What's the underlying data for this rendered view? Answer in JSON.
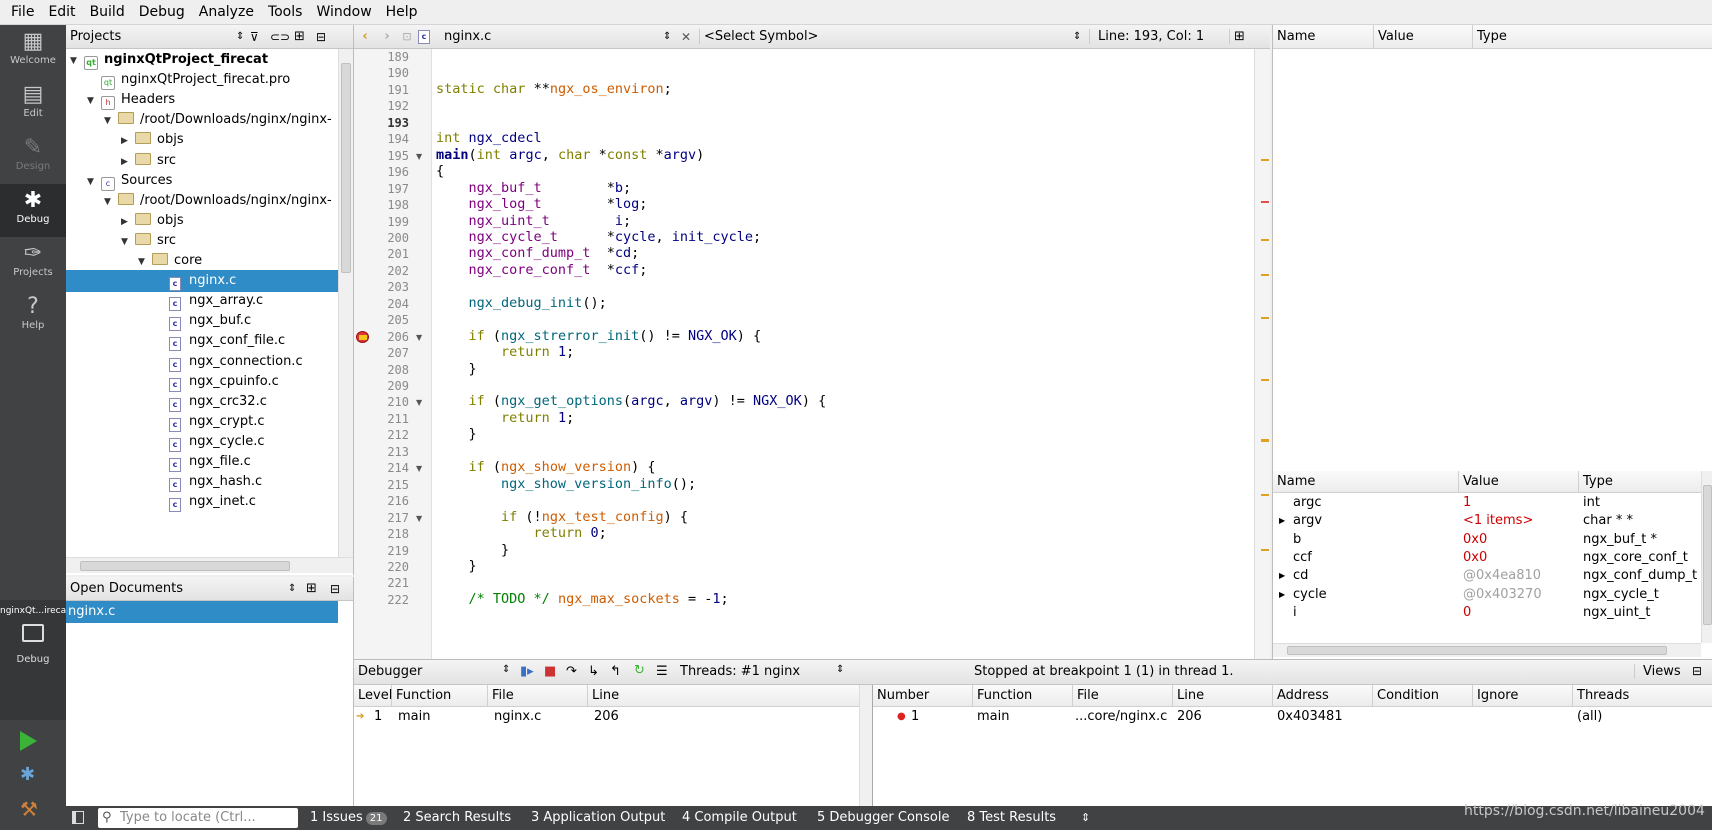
{
  "menu": [
    "File",
    "Edit",
    "Build",
    "Debug",
    "Analyze",
    "Tools",
    "Window",
    "Help"
  ],
  "modes": [
    {
      "label": "Welcome",
      "icon": "grid-icon",
      "glyph": "▦"
    },
    {
      "label": "Edit",
      "icon": "document-icon",
      "glyph": "▤"
    },
    {
      "label": "Design",
      "icon": "pencil-icon",
      "glyph": "✎"
    },
    {
      "label": "Debug",
      "icon": "bug-icon",
      "glyph": "✱"
    },
    {
      "label": "Projects",
      "icon": "wrench-icon",
      "glyph": "✑"
    },
    {
      "label": "Help",
      "icon": "help-icon",
      "glyph": "?"
    }
  ],
  "kit": {
    "project": "nginxQt...irecat",
    "mode": "Debug"
  },
  "projects": {
    "title": "Projects",
    "items": [
      {
        "text": "nginxQtProject_firecat",
        "depth": 0,
        "arrow": "down",
        "icon": "project",
        "bold": true
      },
      {
        "text": "nginxQtProject_firecat.pro",
        "depth": 1,
        "arrow": "",
        "icon": "pro"
      },
      {
        "text": "Headers",
        "depth": 1,
        "arrow": "down",
        "icon": "hdr"
      },
      {
        "text": "/root/Downloads/nginx/nginx-",
        "depth": 2,
        "arrow": "down",
        "icon": "folder"
      },
      {
        "text": "objs",
        "depth": 3,
        "arrow": "right",
        "icon": "folder"
      },
      {
        "text": "src",
        "depth": 3,
        "arrow": "right",
        "icon": "folder"
      },
      {
        "text": "Sources",
        "depth": 1,
        "arrow": "down",
        "icon": "src"
      },
      {
        "text": "/root/Downloads/nginx/nginx-",
        "depth": 2,
        "arrow": "down",
        "icon": "folder"
      },
      {
        "text": "objs",
        "depth": 3,
        "arrow": "right",
        "icon": "folder"
      },
      {
        "text": "src",
        "depth": 3,
        "arrow": "down",
        "icon": "folder"
      },
      {
        "text": "core",
        "depth": 4,
        "arrow": "down",
        "icon": "folder"
      },
      {
        "text": "nginx.c",
        "depth": 5,
        "arrow": "",
        "icon": "c",
        "selected": true
      },
      {
        "text": "ngx_array.c",
        "depth": 5,
        "arrow": "",
        "icon": "c"
      },
      {
        "text": "ngx_buf.c",
        "depth": 5,
        "arrow": "",
        "icon": "c"
      },
      {
        "text": "ngx_conf_file.c",
        "depth": 5,
        "arrow": "",
        "icon": "c"
      },
      {
        "text": "ngx_connection.c",
        "depth": 5,
        "arrow": "",
        "icon": "c"
      },
      {
        "text": "ngx_cpuinfo.c",
        "depth": 5,
        "arrow": "",
        "icon": "c"
      },
      {
        "text": "ngx_crc32.c",
        "depth": 5,
        "arrow": "",
        "icon": "c"
      },
      {
        "text": "ngx_crypt.c",
        "depth": 5,
        "arrow": "",
        "icon": "c"
      },
      {
        "text": "ngx_cycle.c",
        "depth": 5,
        "arrow": "",
        "icon": "c"
      },
      {
        "text": "ngx_file.c",
        "depth": 5,
        "arrow": "",
        "icon": "c"
      },
      {
        "text": "ngx_hash.c",
        "depth": 5,
        "arrow": "",
        "icon": "c"
      },
      {
        "text": "ngx_inet.c",
        "depth": 5,
        "arrow": "",
        "icon": "c"
      }
    ]
  },
  "open_documents": {
    "title": "Open Documents",
    "items": [
      "nginx.c"
    ]
  },
  "editor": {
    "file": "nginx.c",
    "symbol": "<Select Symbol>",
    "position": "Line: 193, Col: 1",
    "lines": [
      {
        "n": "189",
        "html": ""
      },
      {
        "n": "190",
        "html": ""
      },
      {
        "n": "191",
        "html": "<span class=\"kw\">static</span> <span class=\"kw\">char</span> **<span class=\"gl\">ngx_os_environ</span>;"
      },
      {
        "n": "192",
        "html": ""
      },
      {
        "n": "193",
        "html": "",
        "cur": true
      },
      {
        "n": "194",
        "html": "<span class=\"kw\">int</span> <span class=\"mc\">ngx_cdecl</span>"
      },
      {
        "n": "195",
        "html": "<b class=\"mc\">main</b>(<span class=\"kw\">int</span> <span class=\"mc\">argc</span>, <span class=\"kw\">char</span> *<span class=\"kw\">const</span> *<span class=\"mc\">argv</span>)",
        "fold": true
      },
      {
        "n": "196",
        "html": "{"
      },
      {
        "n": "197",
        "html": "    <span class=\"ty\">ngx_buf_t</span>        *<span class=\"mc\">b</span>;"
      },
      {
        "n": "198",
        "html": "    <span class=\"ty\">ngx_log_t</span>        *<span class=\"mc\">log</span>;"
      },
      {
        "n": "199",
        "html": "    <span class=\"ty\">ngx_uint_t</span>        <span class=\"mc\">i</span>;"
      },
      {
        "n": "200",
        "html": "    <span class=\"ty\">ngx_cycle_t</span>      *<span class=\"mc\">cycle</span>, <span class=\"mc\">init_cycle</span>;"
      },
      {
        "n": "201",
        "html": "    <span class=\"ty\">ngx_conf_dump_t</span>  *<span class=\"mc\">cd</span>;"
      },
      {
        "n": "202",
        "html": "    <span class=\"ty\">ngx_core_conf_t</span>  *<span class=\"mc\">ccf</span>;"
      },
      {
        "n": "203",
        "html": ""
      },
      {
        "n": "204",
        "html": "    <span class=\"fn\">ngx_debug_init</span>();"
      },
      {
        "n": "205",
        "html": ""
      },
      {
        "n": "206",
        "html": "    <span class=\"kw\">if</span> (<span class=\"fn\">ngx_strerror_init</span>() != <span class=\"mc\">NGX_OK</span>) {",
        "fold": true,
        "bp": true
      },
      {
        "n": "207",
        "html": "        <span class=\"kw\">return</span> <span class=\"nm\">1</span>;"
      },
      {
        "n": "208",
        "html": "    }"
      },
      {
        "n": "209",
        "html": ""
      },
      {
        "n": "210",
        "html": "    <span class=\"kw\">if</span> (<span class=\"fn\">ngx_get_options</span>(<span class=\"mc\">argc</span>, <span class=\"mc\">argv</span>) != <span class=\"mc\">NGX_OK</span>) {",
        "fold": true
      },
      {
        "n": "211",
        "html": "        <span class=\"kw\">return</span> <span class=\"nm\">1</span>;"
      },
      {
        "n": "212",
        "html": "    }"
      },
      {
        "n": "213",
        "html": ""
      },
      {
        "n": "214",
        "html": "    <span class=\"kw\">if</span> (<span class=\"gl\">ngx_show_version</span>) {",
        "fold": true
      },
      {
        "n": "215",
        "html": "        <span class=\"fn\">ngx_show_version_info</span>();"
      },
      {
        "n": "216",
        "html": ""
      },
      {
        "n": "217",
        "html": "        <span class=\"kw\">if</span> (!<span class=\"gl\">ngx_test_config</span>) {",
        "fold": true
      },
      {
        "n": "218",
        "html": "            <span class=\"kw\">return</span> <span class=\"nm\">0</span>;"
      },
      {
        "n": "219",
        "html": "        }"
      },
      {
        "n": "220",
        "html": "    }"
      },
      {
        "n": "221",
        "html": ""
      },
      {
        "n": "222",
        "html": "    <span class=\"cm\">/* TODO */</span> <span class=\"gl\">ngx_max_sockets</span> = -<span class=\"nm\">1</span>;"
      }
    ]
  },
  "watch": {
    "headers": [
      "Name",
      "Value",
      "Type"
    ]
  },
  "locals": {
    "headers": [
      "Name",
      "Value",
      "Type"
    ],
    "rows": [
      {
        "name": "argc",
        "value": "1",
        "type": "int",
        "arrow": false,
        "vc": "#cc0000"
      },
      {
        "name": "argv",
        "value": "<1 items>",
        "type": "char * *",
        "arrow": true,
        "vc": "#cc0000"
      },
      {
        "name": "b",
        "value": "0x0",
        "type": "ngx_buf_t *",
        "arrow": false,
        "vc": "#cc0000"
      },
      {
        "name": "ccf",
        "value": "0x0",
        "type": "ngx_core_conf_t",
        "arrow": false,
        "vc": "#cc0000"
      },
      {
        "name": "cd",
        "value": "@0x4ea810",
        "type": "ngx_conf_dump_t",
        "arrow": true,
        "vc": "#a0a0a0"
      },
      {
        "name": "cycle",
        "value": "@0x403270",
        "type": "ngx_cycle_t",
        "arrow": true,
        "vc": "#a0a0a0"
      },
      {
        "name": "i",
        "value": "0",
        "type": "ngx_uint_t",
        "arrow": false,
        "vc": "#cc0000"
      }
    ]
  },
  "debugger": {
    "label": "Debugger",
    "threads": "Threads: #1 nginx",
    "status": "Stopped at breakpoint 1 (1) in thread 1.",
    "views": "Views"
  },
  "stack": {
    "headers": [
      "Level",
      "Function",
      "File",
      "Line"
    ],
    "rows": [
      {
        "level": "1",
        "function": "main",
        "file": "nginx.c",
        "line": "206"
      }
    ]
  },
  "breakpoints": {
    "headers": [
      "Number",
      "Function",
      "File",
      "Line",
      "Address",
      "Condition",
      "Ignore",
      "Threads"
    ],
    "rows": [
      {
        "number": "1",
        "function": "main",
        "file": "...core/nginx.c",
        "line": "206",
        "address": "0x403481",
        "condition": "",
        "ignore": "",
        "threads": "(all)"
      }
    ]
  },
  "bottom": {
    "locate_placeholder": "Type to locate (Ctrl...",
    "tabs": [
      {
        "label": "1  Issues",
        "badge": "21"
      },
      {
        "label": "2  Search Results"
      },
      {
        "label": "3  Application Output"
      },
      {
        "label": "4  Compile Output"
      },
      {
        "label": "5  Debugger Console"
      },
      {
        "label": "8  Test Results"
      }
    ],
    "watermark": "https://blog.csdn.net/libaineu2004"
  }
}
